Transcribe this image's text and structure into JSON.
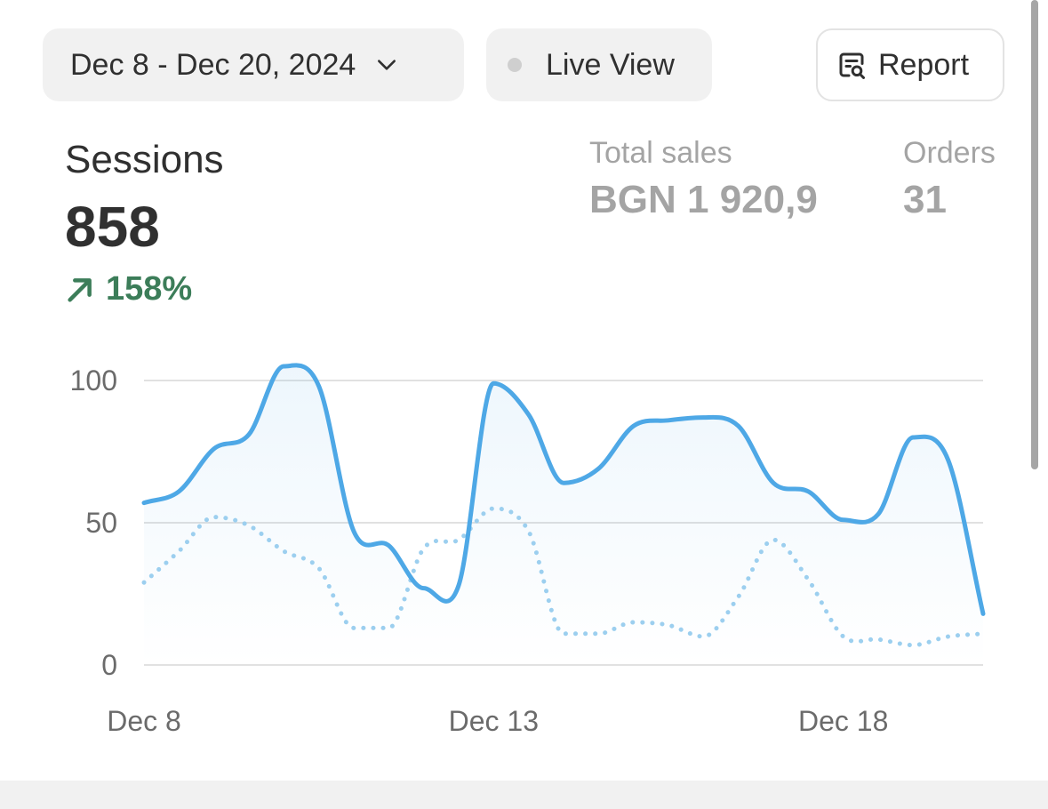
{
  "toolbar": {
    "date_range_label": "Dec 8 - Dec 20, 2024",
    "live_view_label": "Live View",
    "report_label": "Report"
  },
  "metrics": {
    "sessions": {
      "label": "Sessions",
      "value": "858",
      "change": "158%",
      "trend": "up"
    },
    "total_sales": {
      "label": "Total sales",
      "value": "BGN 1 920,9"
    },
    "orders": {
      "label": "Orders",
      "value": "31"
    }
  },
  "colors": {
    "primary_line": "#4ea8e6",
    "comparison_line": "#9ccfef",
    "positive_change": "#3c7d59",
    "gridline": "#e1e1e1"
  },
  "icons": {
    "date_dropdown": "chevron-down-icon",
    "live_status": "status-dot-icon",
    "report": "report-search-icon",
    "trend": "arrow-up-right-icon"
  },
  "chart_data": {
    "type": "line",
    "title": "",
    "xlabel": "",
    "ylabel": "",
    "ylim": [
      0,
      100
    ],
    "y_ticks": [
      "0",
      "50",
      "100"
    ],
    "x_tick_labels": [
      {
        "day": 0,
        "label": "Dec 8"
      },
      {
        "day": 5,
        "label": "Dec 13"
      },
      {
        "day": 10,
        "label": "Dec 18"
      }
    ],
    "grid": true,
    "series": [
      {
        "style": "solid",
        "x": [
          0,
          0.5,
          1,
          1.5,
          2,
          2.5,
          3,
          3.5,
          4,
          4.5,
          5,
          5.5,
          6,
          6.5,
          7,
          7.5,
          8,
          8.5,
          9,
          9.5,
          10,
          10.5,
          11,
          11.5,
          12
        ],
        "values": [
          57,
          61,
          76,
          81,
          105,
          98,
          47,
          42,
          27,
          28,
          99,
          88,
          64,
          69,
          84,
          86,
          87,
          84,
          64,
          61,
          51,
          53,
          80,
          72,
          18
        ]
      },
      {
        "style": "dotted",
        "x": [
          0,
          0.5,
          1,
          1.5,
          2,
          2.5,
          3,
          3.5,
          4,
          4.5,
          5,
          5.5,
          6,
          6.5,
          7,
          7.5,
          8,
          8.5,
          9,
          9.5,
          10,
          10.5,
          11,
          11.5,
          12
        ],
        "values": [
          29,
          40,
          52,
          49,
          40,
          34,
          13,
          13,
          41,
          44,
          55,
          47,
          11,
          11,
          15,
          14,
          10,
          24,
          44,
          30,
          10,
          9,
          7,
          10,
          11
        ]
      }
    ]
  }
}
